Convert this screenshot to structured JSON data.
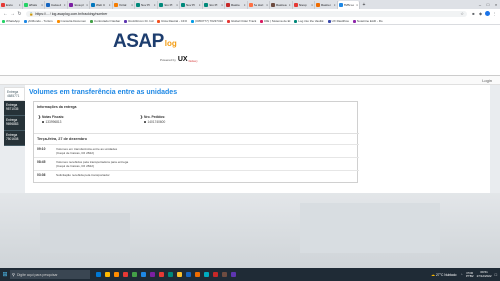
{
  "browser": {
    "tabs": [
      {
        "label": "Enco",
        "color": "#e53935"
      },
      {
        "label": "Whats",
        "color": "#25d366"
      },
      {
        "label": "Caixa d",
        "color": "#1565c0"
      },
      {
        "label": "Nova pl",
        "color": "#7b1fa2"
      },
      {
        "label": "Web C",
        "color": "#0277bd"
      },
      {
        "label": "Portal",
        "color": "#f57c00"
      },
      {
        "label": "Nov Pl",
        "color": "#00897b"
      },
      {
        "label": "Nov Pl",
        "color": "#00897b"
      },
      {
        "label": "Nov Pl",
        "color": "#00897b"
      },
      {
        "label": "Nov Pl",
        "color": "#00897b"
      },
      {
        "label": "Rastre",
        "color": "#c62828"
      },
      {
        "label": "As Hori",
        "color": "#ff7043"
      },
      {
        "label": "Rastrea",
        "color": "#6d4c41"
      },
      {
        "label": "Aliexp",
        "color": "#e53935"
      },
      {
        "label": "Rastrei",
        "color": "#ef6c00"
      },
      {
        "label": "TMS Lo",
        "color": "#1e88e5"
      }
    ],
    "new_tab": "+",
    "url": "https://... / log.asaplog.com.br/tracking/number",
    "bookmarks": [
      {
        "label": "WhatsApp",
        "color": "#25d366"
      },
      {
        "label": "yfcMundo - Turism",
        "color": "#1e88e5"
      },
      {
        "label": "Consulta Documen",
        "color": "#fb8c00"
      },
      {
        "label": "Controlador Navbar",
        "color": "#43a047"
      },
      {
        "label": "RodoSCom Dr. Ind",
        "color": "#5e35b1"
      },
      {
        "label": "Rota Rastral - CFO",
        "color": "#f4511e"
      },
      {
        "label": "(0050777) 70237310",
        "color": "#039be5"
      },
      {
        "label": "Global Order Track",
        "color": "#e53935"
      },
      {
        "label": "DIE | Sistema de El",
        "color": "#d81b60"
      },
      {
        "label": "Log into the Vaultik",
        "color": "#00897b"
      },
      {
        "label": "UX Rastilhos",
        "color": "#3949ab"
      },
      {
        "label": "Notetrine EAD - Ro",
        "color": "#8e24aa"
      }
    ]
  },
  "header": {
    "logo_main": "ASAP",
    "logo_sub": "log",
    "powered_by": "Powered by",
    "ux_mark": "UX",
    "ux_suffix": "Delivery"
  },
  "userbar": {
    "user": "Login"
  },
  "sidebar": {
    "items": [
      {
        "line1": "Entrega",
        "line2": "4685771"
      },
      {
        "line1": "Entrega",
        "line2": "9571035"
      },
      {
        "line1": "Entrega",
        "line2": "9696883"
      },
      {
        "line1": "Entrega",
        "line2": "7501608"
      }
    ]
  },
  "main": {
    "title": "Volumes em transferência entre as unidades",
    "info_title": "Informações da entrega",
    "nota_label": "Notas Fiscais:",
    "nota_value": "133996813",
    "pedido_label": "Nro. Pedidos:",
    "pedido_value": "1401740600",
    "date_heading": "Terça-feira, 27 de dezembro",
    "events": [
      {
        "time": "09:10",
        "line1": "Volumes em transferência entre as unidades",
        "line2": "(Caqui de Caixas, RJ 2822)"
      },
      {
        "time": "08:45",
        "line1": "Volumes recebidos pela transportadora para entrega",
        "line2": "(Caqui de Caixas, RJ 2822)"
      },
      {
        "time": "03:36",
        "line1": "Solicitação recebida pela transportador",
        "line2": ""
      }
    ]
  },
  "taskbar": {
    "search_placeholder": "Digite aqui para pesquisar",
    "apps": [
      "#0078d4",
      "#ffb900",
      "#ff8c00",
      "#e53935",
      "#43a047",
      "#1e88e5",
      "#7b1fa2",
      "#e53935",
      "#00897b",
      "#fbc02d",
      "#1565c0",
      "#ef6c00",
      "#00acc1",
      "#c62828",
      "#6d4c41",
      "#5e35b1"
    ],
    "weather": "27°C Nublado",
    "lang1": "POR",
    "lang2": "PTB2",
    "time": "09:51",
    "date": "27/12/2022"
  }
}
